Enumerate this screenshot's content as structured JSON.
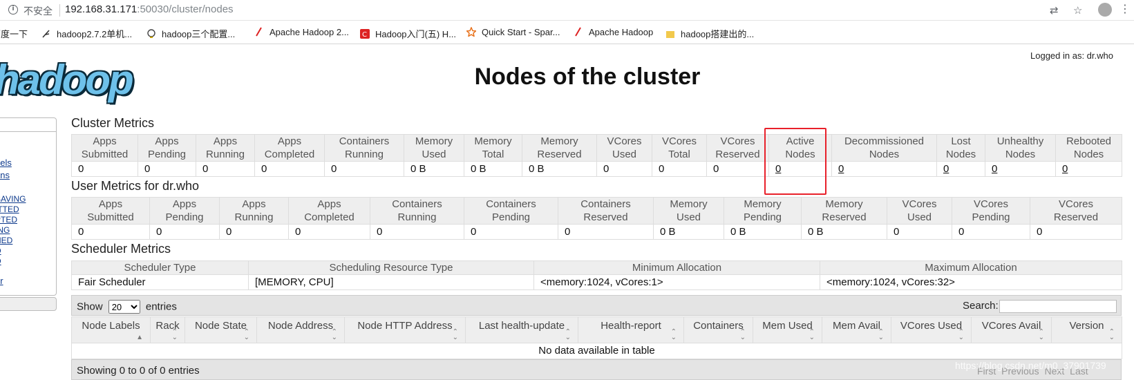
{
  "browser": {
    "security_label": "不安全",
    "url_host": "192.168.31.171",
    "url_rest": ":50030/cluster/nodes"
  },
  "bookmarks": [
    {
      "label": "百度一下",
      "icon": "paw-icon",
      "color": "#3b5bdb"
    },
    {
      "label": "hadoop2.7.2单机...",
      "icon": "feather-icon",
      "color": "#333"
    },
    {
      "label": "hadoop三个配置...",
      "icon": "bulb-icon",
      "color": "#caa300"
    },
    {
      "label": "Apache Hadoop 2...",
      "icon": "feather-icon",
      "color": "#d22"
    },
    {
      "label": "Hadoop入门(五) H...",
      "icon": "csdn-icon",
      "color": "#d22"
    },
    {
      "label": "Quick Start - Spar...",
      "icon": "star-icon",
      "color": "#e8711a"
    },
    {
      "label": "Apache Hadoop",
      "icon": "feather-icon",
      "color": "#d22"
    },
    {
      "label": "hadoop搭建出的...",
      "icon": "folder-icon",
      "color": "#f2c94c"
    }
  ],
  "header": {
    "logo_text": "hadoop",
    "logged_in": "Logged in as: dr.who",
    "title": "Nodes of the cluster"
  },
  "nav": {
    "links": [
      "bels",
      "ons",
      "SAVING",
      "ITTED",
      "PTED",
      "ING",
      "HED",
      "D",
      "D",
      "er"
    ]
  },
  "cluster_metrics": {
    "title": "Cluster Metrics",
    "headers": [
      [
        "Apps",
        "Submitted"
      ],
      [
        "Apps",
        "Pending"
      ],
      [
        "Apps",
        "Running"
      ],
      [
        "Apps",
        "Completed"
      ],
      [
        "Containers",
        "Running"
      ],
      [
        "Memory",
        "Used"
      ],
      [
        "Memory",
        "Total"
      ],
      [
        "Memory",
        "Reserved"
      ],
      [
        "VCores",
        "Used"
      ],
      [
        "VCores",
        "Total"
      ],
      [
        "VCores",
        "Reserved"
      ],
      [
        "Active",
        "Nodes"
      ],
      [
        "Decommissioned",
        "Nodes"
      ],
      [
        "Lost",
        "Nodes"
      ],
      [
        "Unhealthy",
        "Nodes"
      ],
      [
        "Rebooted",
        "Nodes"
      ]
    ],
    "values": [
      "0",
      "0",
      "0",
      "0",
      "0",
      "0 B",
      "0 B",
      "0 B",
      "0",
      "0",
      "0",
      "0",
      "0",
      "0",
      "0",
      "0"
    ]
  },
  "user_metrics": {
    "title": "User Metrics for dr.who",
    "headers": [
      [
        "Apps",
        "Submitted"
      ],
      [
        "Apps",
        "Pending"
      ],
      [
        "Apps",
        "Running"
      ],
      [
        "Apps",
        "Completed"
      ],
      [
        "Containers",
        "Running"
      ],
      [
        "Containers",
        "Pending"
      ],
      [
        "Containers",
        "Reserved"
      ],
      [
        "Memory",
        "Used"
      ],
      [
        "Memory",
        "Pending"
      ],
      [
        "Memory",
        "Reserved"
      ],
      [
        "VCores",
        "Used"
      ],
      [
        "VCores",
        "Pending"
      ],
      [
        "VCores",
        "Reserved"
      ]
    ],
    "values": [
      "0",
      "0",
      "0",
      "0",
      "0",
      "0",
      "0",
      "0 B",
      "0 B",
      "0 B",
      "0",
      "0",
      "0"
    ]
  },
  "scheduler_metrics": {
    "title": "Scheduler Metrics",
    "headers": [
      "Scheduler Type",
      "Scheduling Resource Type",
      "Minimum Allocation",
      "Maximum Allocation"
    ],
    "values": [
      "Fair Scheduler",
      "[MEMORY, CPU]",
      "<memory:1024, vCores:1>",
      "<memory:1024, vCores:32>"
    ]
  },
  "nodes_table": {
    "show_label": "Show",
    "entries_label": "entries",
    "page_size": "20",
    "search_label": "Search:",
    "columns": [
      "Node Labels",
      "Rack",
      "Node State",
      "Node Address",
      "Node HTTP Address",
      "Last health-update",
      "Health-report",
      "Containers",
      "Mem Used",
      "Mem Avail",
      "VCores Used",
      "VCores Avail",
      "Version"
    ],
    "empty_message": "No data available in table",
    "info": "Showing 0 to 0 of 0 entries",
    "pager": [
      "First",
      "Previous",
      "Next",
      "Last"
    ]
  },
  "watermark": "https://blog.csdn.net/m0_37901739"
}
